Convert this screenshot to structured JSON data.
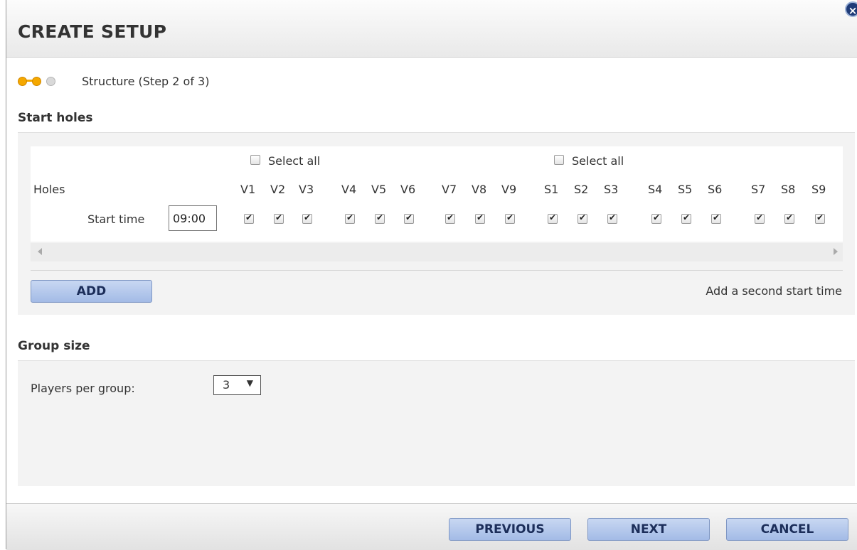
{
  "dialog": {
    "title": "CREATE SETUP",
    "close_glyph": "×"
  },
  "step": {
    "text": "Structure (Step 2 of 3)",
    "current": 2,
    "total": 3
  },
  "start_holes": {
    "title": "Start holes",
    "select_all_label": "Select all",
    "holes_label": "Holes",
    "start_time_label": "Start time",
    "start_time_value": "09:00",
    "holes": [
      "V1",
      "V2",
      "V3",
      "V4",
      "V5",
      "V6",
      "V7",
      "V8",
      "V9",
      "S1",
      "S2",
      "S3",
      "S4",
      "S5",
      "S6",
      "S7",
      "S8",
      "S9"
    ],
    "checked": [
      true,
      true,
      true,
      true,
      true,
      true,
      true,
      true,
      true,
      true,
      true,
      true,
      true,
      true,
      true,
      true,
      true,
      true
    ],
    "select_all_checked": [
      false,
      false
    ],
    "add_button": "ADD",
    "add_hint": "Add a second start time"
  },
  "group_size": {
    "title": "Group size",
    "players_label": "Players per group:",
    "selected": "3",
    "caret": "▼"
  },
  "footer": {
    "previous": "PREVIOUS",
    "next": "NEXT",
    "cancel": "CANCEL"
  },
  "colors": {
    "accent": "#f5a800",
    "button": "#a3bbe6",
    "button_text": "#1c2e5a"
  }
}
